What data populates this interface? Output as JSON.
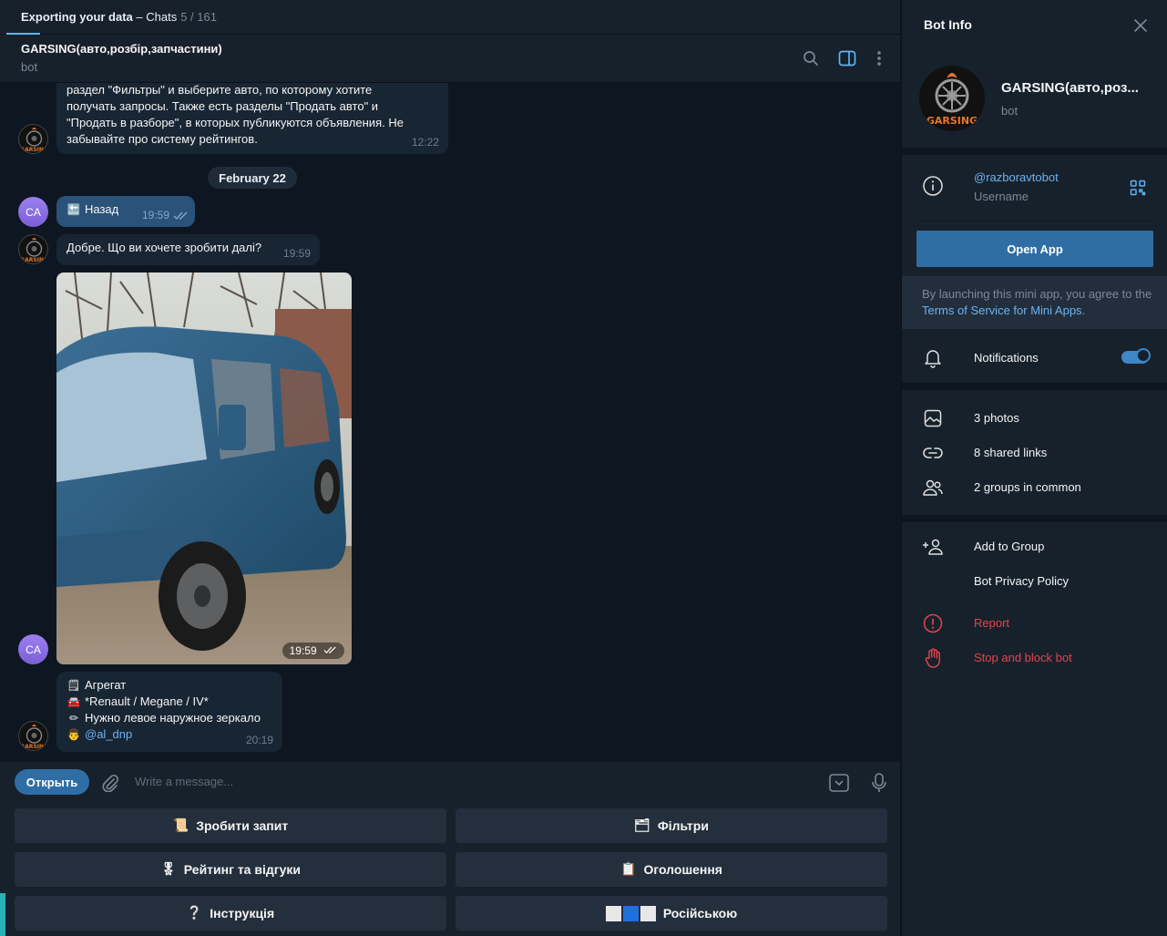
{
  "topbar": {
    "title": "Exporting your data",
    "dash": " – Chats",
    "count": "5 / 161"
  },
  "chat": {
    "name": "GARSING(авто,розбір,запчастини)",
    "status": "bot"
  },
  "messages": {
    "m1": {
      "lines": [
        "раздел \"Фильтры\" и выберите авто, по которому хотите",
        "получать запросы. Также есть разделы \"Продать авто\" и",
        "\"Продать в разборе\", в которых публикуются объявления. Не",
        "забывайте про систему рейтингов."
      ],
      "time": "12:22"
    },
    "date": "February 22",
    "m2": {
      "icon": "back-arrow-emoji",
      "text": "Назад",
      "time": "19:59"
    },
    "m3": {
      "text": "Добре. Що ви хочете зробити далі?",
      "time": "19:59"
    },
    "m4": {
      "time": "19:59"
    },
    "m5": {
      "line1": "Агрегат",
      "line2": "*Renault / Megane / IV*",
      "line3": "Нужно левое наружное зеркало",
      "mention": "@al_dnp",
      "time": "20:19"
    },
    "avatar_initials": "CA"
  },
  "composer": {
    "open_label": "Открыть",
    "placeholder": "Write a message..."
  },
  "keyboard": {
    "b1": {
      "icon": "scroll-emoji",
      "label": "Зробити запит"
    },
    "b2": {
      "icon": "filter-emoji",
      "label": "Фільтри"
    },
    "b3": {
      "icon": "medal-emoji",
      "label": "Рейтинг та відгуки"
    },
    "b4": {
      "icon": "clipboard-emoji",
      "label": "Оголошення"
    },
    "b5": {
      "icon": "question-emoji",
      "label": "Інструкція"
    },
    "b6": {
      "icon": "flag-emoji",
      "label": "Російською"
    }
  },
  "panel": {
    "title": "Bot Info",
    "name": "GARSING(авто,роз...",
    "status": "bot",
    "username": "@razboravtobot",
    "username_label": "Username",
    "open_app": "Open App",
    "terms_pre": "By launching this mini app, you agree to the ",
    "terms_link": "Terms of Service for Mini Apps",
    "terms_post": ".",
    "notifications": "Notifications",
    "notifications_on": true,
    "photos": "3 photos",
    "links": "8 shared links",
    "groups": "2 groups in common",
    "add_group": "Add to Group",
    "privacy": "Bot Privacy Policy",
    "report": "Report",
    "stop": "Stop and block bot"
  },
  "colors": {
    "accent": "#2f6ea5",
    "link": "#6ab3f3",
    "danger": "#e5444c",
    "bubble_in": "#182533",
    "bubble_out": "#2b5278"
  },
  "logo_text": "GARSING"
}
